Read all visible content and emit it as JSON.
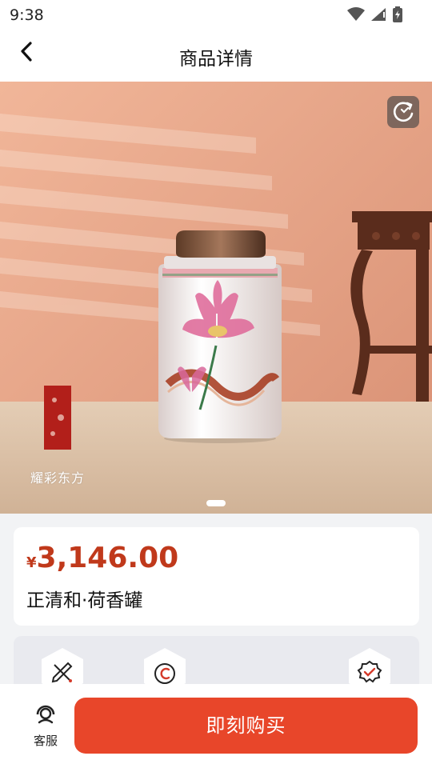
{
  "status_bar": {
    "time": "9:38"
  },
  "header": {
    "title": "商品详情",
    "back_icon": "chevron-left-icon"
  },
  "hero": {
    "brand_name": "耀彩东方",
    "refresh_icon": "refresh-icon",
    "pager": {
      "current": 1,
      "total": 1
    }
  },
  "product": {
    "currency": "¥",
    "price": "3,146.00",
    "name": "正清和·荷香罐",
    "price_color": "#c0391b"
  },
  "features": {
    "icons": [
      "pencil-ruler-icon",
      "copyright-icon",
      "verified-badge-icon"
    ]
  },
  "bottom_bar": {
    "service_label": "客服",
    "service_icon": "headset-icon",
    "buy_label": "即刻购买",
    "buy_color": "#e8462a"
  }
}
